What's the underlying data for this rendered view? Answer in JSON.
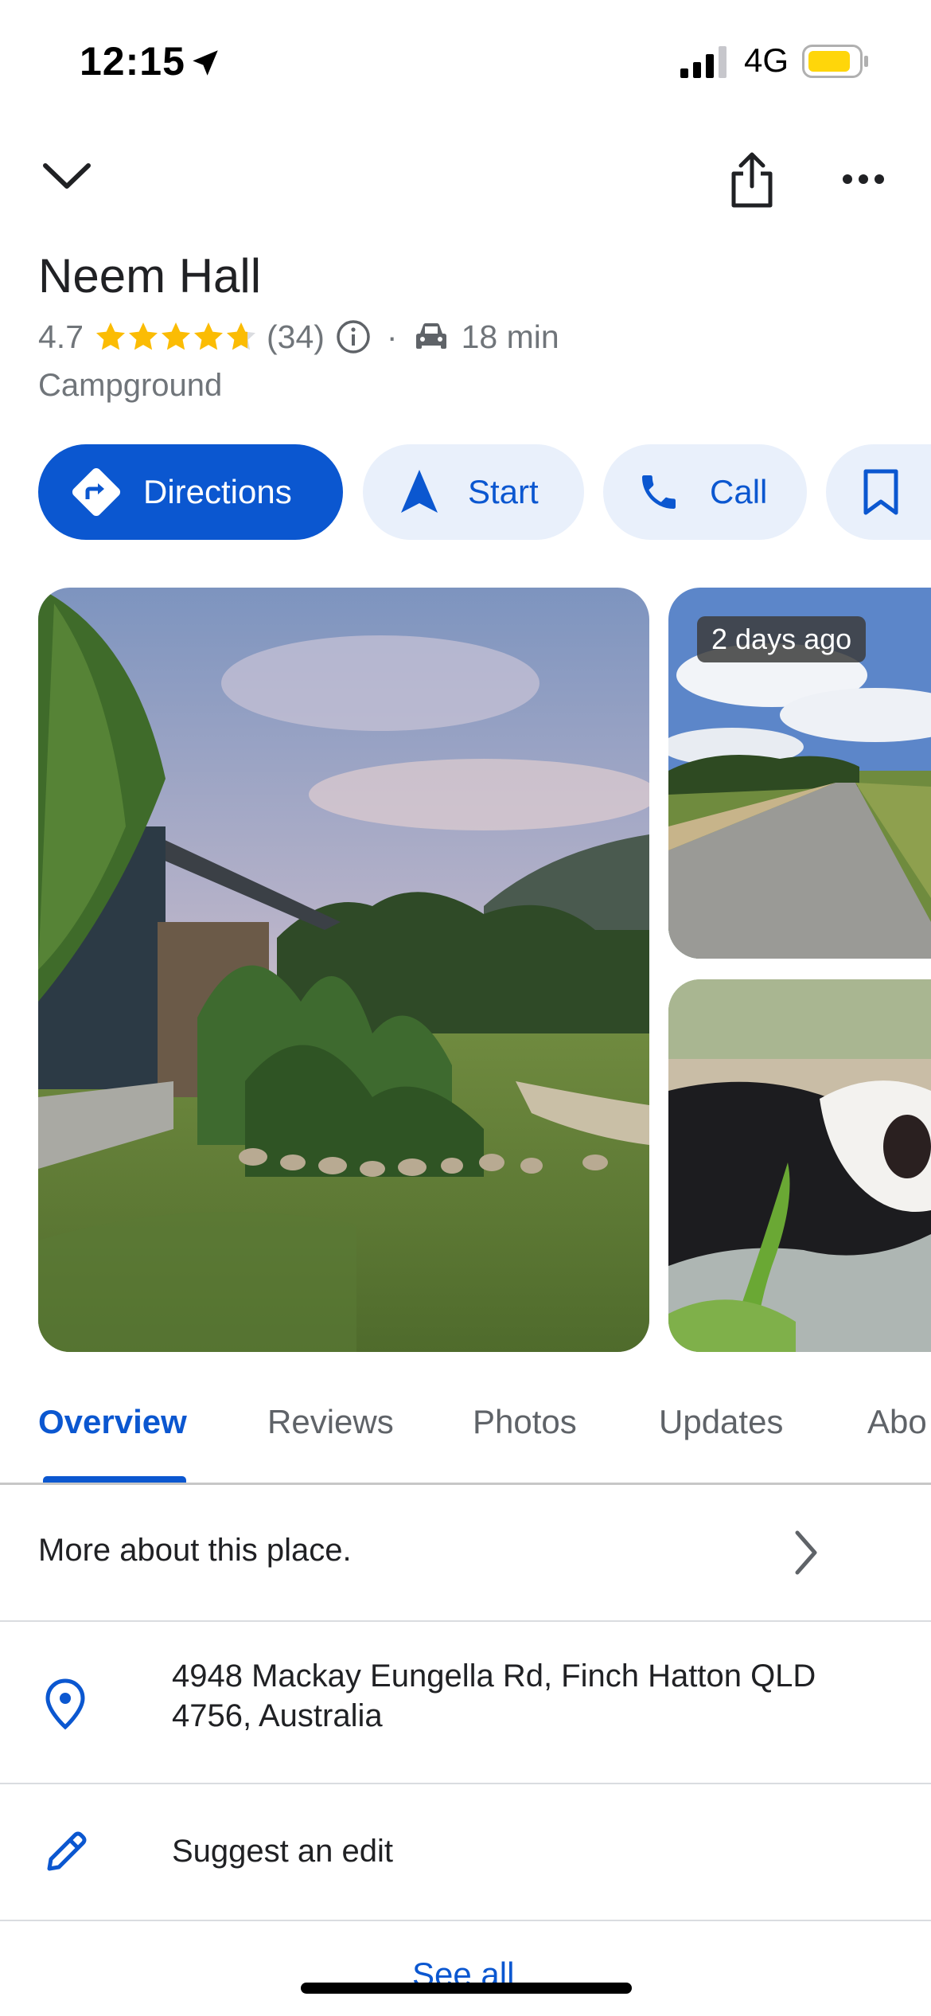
{
  "status_bar": {
    "time": "12:15",
    "network": "4G"
  },
  "place": {
    "title": "Neem Hall",
    "rating": "4.7",
    "review_count": "(34)",
    "drive_time": "18 min",
    "category": "Campground"
  },
  "actions": [
    {
      "label": "Directions"
    },
    {
      "label": "Start"
    },
    {
      "label": "Call"
    },
    {
      "label": ""
    }
  ],
  "photos": {
    "badge": "2 days ago"
  },
  "tabs": [
    "Overview",
    "Reviews",
    "Photos",
    "Updates",
    "Abo"
  ],
  "rows": {
    "more_about": "More about this place.",
    "address_line1": "4948 Mackay Eungella Rd, Finch Hatton QLD",
    "address_line2": "4756, Australia",
    "suggest_edit": "Suggest an edit"
  },
  "see_all": "See all",
  "colors": {
    "accent": "#0b57d0",
    "star": "#fbbc04",
    "chip_bg": "#e9f0fb",
    "battery": "#ffd60a"
  },
  "icons": [
    "location-arrow-icon",
    "signal-icon",
    "battery-icon",
    "chevron-down-icon",
    "share-icon",
    "more-icon",
    "info-icon",
    "car-icon",
    "directions-icon",
    "navigation-icon",
    "phone-icon",
    "bookmark-icon",
    "chevron-right-icon",
    "location-pin-icon",
    "pencil-icon"
  ]
}
